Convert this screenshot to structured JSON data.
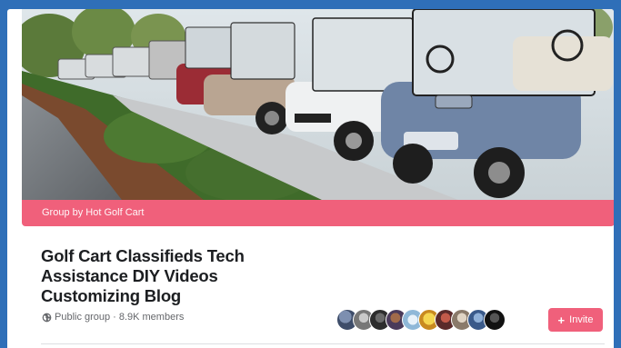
{
  "cover": {
    "group_label": "Group by Hot Golf Cart"
  },
  "group": {
    "title": "Golf Cart Classifieds Tech Assistance DIY Videos Customizing Blog",
    "privacy": "Public group",
    "separator": "·",
    "members": "8.9K members"
  },
  "members_preview": {
    "avatar_colors": [
      "#4a5a7a",
      "#9a9a9a",
      "#3b3b3b",
      "#6a4a3a",
      "#b8d4e8",
      "#e8c040",
      "#8a3b3b",
      "#c8b8a8",
      "#5a7aa8",
      "#2a2a2a"
    ]
  },
  "actions": {
    "invite_label": "Invite"
  },
  "colors": {
    "accent": "#f0607b",
    "frame": "#2f6fb8"
  },
  "icons": {
    "privacy": "globe-icon",
    "invite": "plus-icon"
  }
}
